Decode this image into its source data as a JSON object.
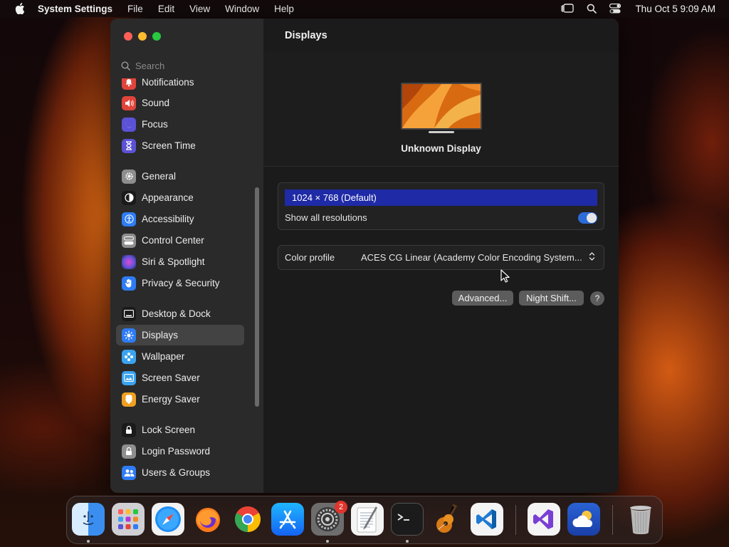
{
  "menubar": {
    "app_name": "System Settings",
    "menus": [
      "File",
      "Edit",
      "View",
      "Window",
      "Help"
    ],
    "clock": "Thu Oct 5  9:09 AM"
  },
  "sidebar": {
    "search_placeholder": "Search",
    "items": [
      {
        "label": "Notifications",
        "icon": "bell-icon",
        "color": "#e0443a"
      },
      {
        "label": "Sound",
        "icon": "speaker-icon",
        "color": "#e0443a"
      },
      {
        "label": "Focus",
        "icon": "moon-icon",
        "color": "#5b52d6"
      },
      {
        "label": "Screen Time",
        "icon": "hourglass-icon",
        "color": "#5b52d6"
      },
      {
        "label": "General",
        "icon": "gear-icon",
        "color": "#8e8e8e"
      },
      {
        "label": "Appearance",
        "icon": "appearance-icon",
        "color": "#1a1a1a"
      },
      {
        "label": "Accessibility",
        "icon": "accessibility-icon",
        "color": "#2e7cf6"
      },
      {
        "label": "Control Center",
        "icon": "control-center-icon",
        "color": "#8e8e8e"
      },
      {
        "label": "Siri & Spotlight",
        "icon": "siri-icon",
        "color": "#b03ad6"
      },
      {
        "label": "Privacy & Security",
        "icon": "hand-icon",
        "color": "#2e7cf6"
      },
      {
        "label": "Desktop & Dock",
        "icon": "desktop-icon",
        "color": "#1a1a1a"
      },
      {
        "label": "Displays",
        "icon": "displays-icon",
        "color": "#2e7cf6"
      },
      {
        "label": "Wallpaper",
        "icon": "wallpaper-icon",
        "color": "#3aa3f0"
      },
      {
        "label": "Screen Saver",
        "icon": "screen-saver-icon",
        "color": "#3aa3f0"
      },
      {
        "label": "Energy Saver",
        "icon": "battery-icon",
        "color": "#f0a020"
      },
      {
        "label": "Lock Screen",
        "icon": "lock-icon",
        "color": "#1a1a1a"
      },
      {
        "label": "Login Password",
        "icon": "password-icon",
        "color": "#8e8e8e"
      },
      {
        "label": "Users & Groups",
        "icon": "users-icon",
        "color": "#2e7cf6"
      }
    ],
    "selected": "Displays"
  },
  "content": {
    "title": "Displays",
    "display_name": "Unknown Display",
    "resolution": "1024 × 768 (Default)",
    "show_all_label": "Show all resolutions",
    "show_all_enabled": true,
    "color_profile_label": "Color profile",
    "color_profile_value": "ACES CG Linear (Academy Color Encoding System...",
    "advanced_button": "Advanced...",
    "night_shift_button": "Night Shift...",
    "help_button": "?"
  },
  "dock": {
    "apps": [
      "Finder",
      "Launchpad",
      "Safari",
      "Firefox",
      "Chrome",
      "App Store",
      "System Settings",
      "TextEdit",
      "Terminal",
      "GarageBand",
      "Visual Studio Code",
      "Visual Studio",
      "Weather",
      "Trash"
    ],
    "settings_badge": "2"
  }
}
